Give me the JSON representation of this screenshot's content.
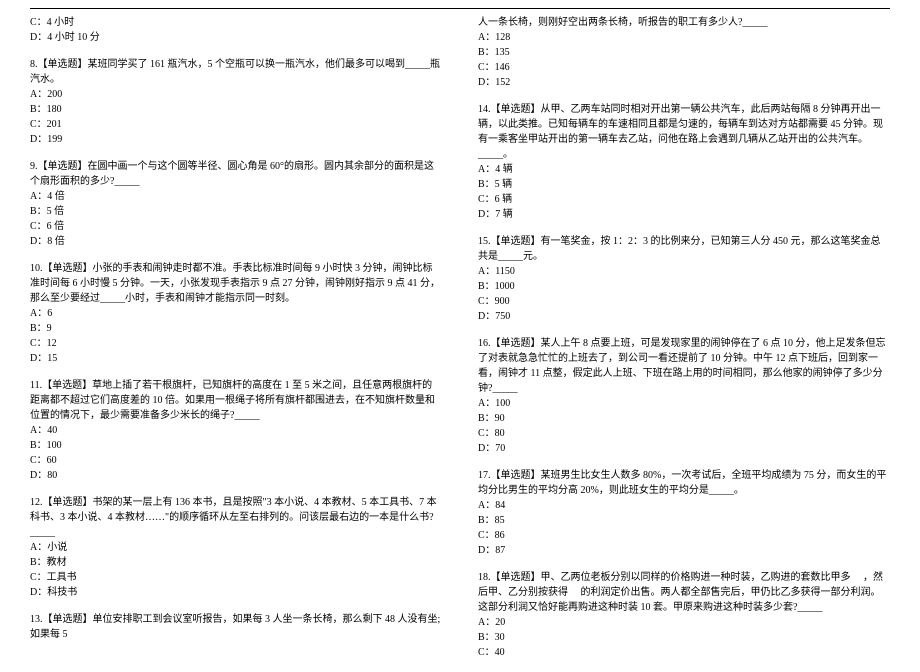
{
  "left": {
    "q7tail": {
      "options": [
        "C：4 小时",
        "D：4 小时 10 分"
      ]
    },
    "q8": {
      "stem": "8.【单选题】某班同学买了 161 瓶汽水，5 个空瓶可以换一瓶汽水，他们最多可以喝到_____瓶汽水。",
      "options": [
        "A：200",
        "B：180",
        "C：201",
        "D：199"
      ]
    },
    "q9": {
      "stem": "9.【单选题】在圆中画一个与这个圆等半径、圆心角是 60°的扇形。圆内其余部分的面积是这个扇形面积的多少?_____",
      "options": [
        "A：4 倍",
        "B：5 倍",
        "C：6 倍",
        "D：8 倍"
      ]
    },
    "q10": {
      "stem": "10.【单选题】小张的手表和闹钟走时都不准。手表比标准时间每 9 小时快 3 分钟，闹钟比标准时间每 6 小时慢 5 分钟。一天，小张发现手表指示 9 点 27 分钟，闹钟刚好指示 9 点 41 分，那么至少要经过_____小时，手表和闹钟才能指示同一时刻。",
      "options": [
        "A：6",
        "B：9",
        "C：12",
        "D：15"
      ]
    },
    "q11": {
      "stem": "11.【单选题】草地上插了若干根旗杆，已知旗杆的高度在 1 至 5 米之间，且任意两根旗杆的距离都不超过它们高度差的 10 倍。如果用一根绳子将所有旗杆都围进去，在不知旗杆数量和位置的情况下，最少需要准备多少米长的绳子?_____",
      "options": [
        "A：40",
        "B：100",
        "C：60",
        "D：80"
      ]
    },
    "q12": {
      "stem": "12.【单选题】书架的某一层上有 136 本书，且是按照\"3 本小说、4 本教材、5 本工具书、7 本科书、3 本小说、4 本教材……\"的顺序循环从左至右排列的。问该层最右边的一本是什么书?_____",
      "options": [
        "A：小说",
        "B：教材",
        "C：工具书",
        "D：科技书"
      ]
    },
    "q13": {
      "stem": "13.【单选题】单位安排职工到会议室听报告，如果每 3 人坐一条长椅，那么剩下 48 人没有坐;如果每 5"
    }
  },
  "right": {
    "q13cont": {
      "stem": "人一条长椅，则刚好空出两条长椅，听报告的职工有多少人?_____",
      "options": [
        "A：128",
        "B：135",
        "C：146",
        "D：152"
      ]
    },
    "q14": {
      "stem": "14.【单选题】从甲、乙两车站同时相对开出第一辆公共汽车，此后两站每隔 8 分钟再开出一辆，以此类推。已知每辆车的车速相同且都是匀速的，每辆车到达对方站都需要 45 分钟。现有一乘客坐甲站开出的第一辆车去乙站，问他在路上会遇到几辆从乙站开出的公共汽车。_____。",
      "options": [
        "A：4 辆",
        "B：5 辆",
        "C：6 辆",
        "D：7 辆"
      ]
    },
    "q15": {
      "stem": "15.【单选题】有一笔奖金，按 1：2：3 的比例来分，已知第三人分 450 元，那么这笔奖金总共是_____元。",
      "options": [
        "A：1150",
        "B：1000",
        "C：900",
        "D：750"
      ]
    },
    "q16": {
      "stem": "16.【单选题】某人上午 8 点要上班，可是发现家里的闹钟停在了 6 点 10 分，他上足发条但忘了对表就急急忙忙的上班去了，到公司一看还提前了 10 分钟。中午 12 点下班后，回到家一看，闹钟才 11 点整，假定此人上班、下班在路上用的时间相同，那么他家的闹钟停了多少分钟?_____",
      "options": [
        "A：100",
        "B：90",
        "C：80",
        "D：70"
      ]
    },
    "q17": {
      "stem": "17.【单选题】某班男生比女生人数多 80%，一次考试后，全班平均成绩为 75 分，而女生的平均分比男生的平均分高 20%，则此班女生的平均分是_____。",
      "options": [
        "A：84",
        "B：85",
        "C：86",
        "D：87"
      ]
    },
    "q18": {
      "stem": "18.【单选题】甲、乙两位老板分别以同样的价格购进一种时装，乙购进的套数比甲多 　，然后甲、乙分别按获得 　的利润定价出售。两人都全部售完后，甲仍比乙多获得一部分利润。这部分利润又恰好能再购进这种时装 10 套。甲原来购进这种时装多少套?_____",
      "options": [
        "A：20",
        "B：30",
        "C：40"
      ]
    }
  }
}
